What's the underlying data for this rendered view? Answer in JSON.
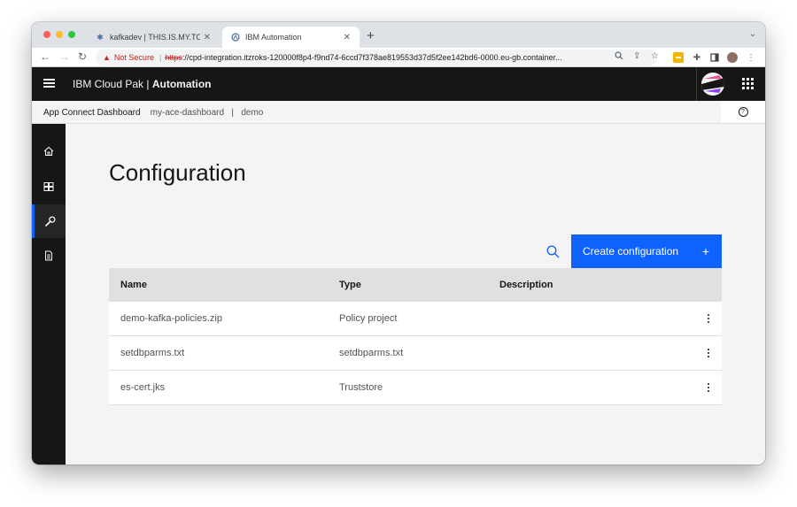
{
  "browser": {
    "tabs": [
      {
        "title": "kafkadev | THIS.IS.MY.TOPIC |",
        "icon": "kafka-icon"
      },
      {
        "title": "IBM Automation",
        "icon": "ibm-automation-icon"
      }
    ],
    "url": {
      "security_label": "Not Secure",
      "scheme": "https",
      "rest": "://cpd-integration.itzroks-120000f8p4-f9nd74-6ccd7f378ae819553d37d5f2ee142bd6-0000.eu-gb.container..."
    }
  },
  "header": {
    "brand_prefix": "IBM Cloud Pak | ",
    "brand_product": "Automation"
  },
  "breadcrumb": {
    "app": "App Connect Dashboard",
    "dashboard": "my-ace-dashboard",
    "separator": "|",
    "namespace": "demo"
  },
  "sidenav": {
    "items": [
      {
        "name": "home",
        "icon": "home-icon",
        "active": false
      },
      {
        "name": "dashboard",
        "icon": "dashboard-icon",
        "active": false
      },
      {
        "name": "configuration",
        "icon": "wrench-icon",
        "active": true
      },
      {
        "name": "documents",
        "icon": "document-icon",
        "active": false
      }
    ]
  },
  "main": {
    "title": "Configuration",
    "create_button_label": "Create configuration",
    "table": {
      "headers": [
        "Name",
        "Type",
        "Description"
      ],
      "rows": [
        {
          "name": "demo-kafka-policies.zip",
          "type": "Policy project",
          "description": ""
        },
        {
          "name": "setdbparms.txt",
          "type": "setdbparms.txt",
          "description": ""
        },
        {
          "name": "es-cert.jks",
          "type": "Truststore",
          "description": ""
        }
      ]
    }
  },
  "colors": {
    "accent": "#0f62fe",
    "header_bg": "#161616",
    "page_bg": "#f4f4f4"
  }
}
